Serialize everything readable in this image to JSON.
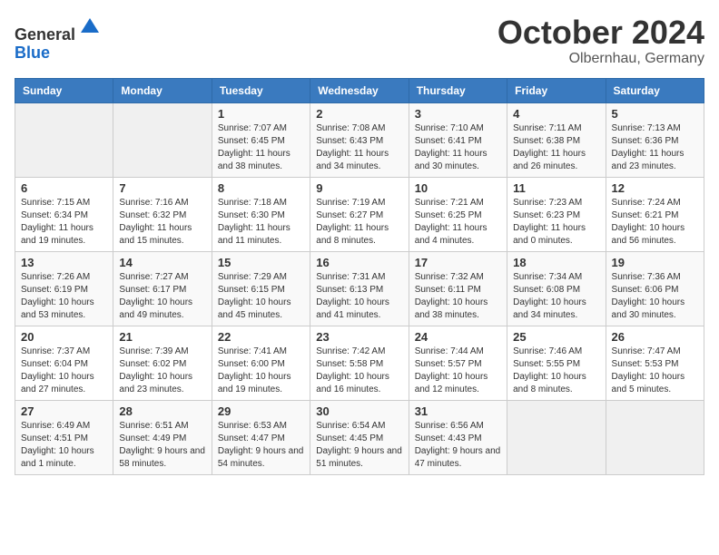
{
  "header": {
    "logo": {
      "line1": "General",
      "line2": "Blue"
    },
    "month": "October 2024",
    "location": "Olbernhau, Germany"
  },
  "weekdays": [
    "Sunday",
    "Monday",
    "Tuesday",
    "Wednesday",
    "Thursday",
    "Friday",
    "Saturday"
  ],
  "weeks": [
    [
      {
        "day": "",
        "info": ""
      },
      {
        "day": "",
        "info": ""
      },
      {
        "day": "1",
        "info": "Sunrise: 7:07 AM\nSunset: 6:45 PM\nDaylight: 11 hours and 38 minutes."
      },
      {
        "day": "2",
        "info": "Sunrise: 7:08 AM\nSunset: 6:43 PM\nDaylight: 11 hours and 34 minutes."
      },
      {
        "day": "3",
        "info": "Sunrise: 7:10 AM\nSunset: 6:41 PM\nDaylight: 11 hours and 30 minutes."
      },
      {
        "day": "4",
        "info": "Sunrise: 7:11 AM\nSunset: 6:38 PM\nDaylight: 11 hours and 26 minutes."
      },
      {
        "day": "5",
        "info": "Sunrise: 7:13 AM\nSunset: 6:36 PM\nDaylight: 11 hours and 23 minutes."
      }
    ],
    [
      {
        "day": "6",
        "info": "Sunrise: 7:15 AM\nSunset: 6:34 PM\nDaylight: 11 hours and 19 minutes."
      },
      {
        "day": "7",
        "info": "Sunrise: 7:16 AM\nSunset: 6:32 PM\nDaylight: 11 hours and 15 minutes."
      },
      {
        "day": "8",
        "info": "Sunrise: 7:18 AM\nSunset: 6:30 PM\nDaylight: 11 hours and 11 minutes."
      },
      {
        "day": "9",
        "info": "Sunrise: 7:19 AM\nSunset: 6:27 PM\nDaylight: 11 hours and 8 minutes."
      },
      {
        "day": "10",
        "info": "Sunrise: 7:21 AM\nSunset: 6:25 PM\nDaylight: 11 hours and 4 minutes."
      },
      {
        "day": "11",
        "info": "Sunrise: 7:23 AM\nSunset: 6:23 PM\nDaylight: 11 hours and 0 minutes."
      },
      {
        "day": "12",
        "info": "Sunrise: 7:24 AM\nSunset: 6:21 PM\nDaylight: 10 hours and 56 minutes."
      }
    ],
    [
      {
        "day": "13",
        "info": "Sunrise: 7:26 AM\nSunset: 6:19 PM\nDaylight: 10 hours and 53 minutes."
      },
      {
        "day": "14",
        "info": "Sunrise: 7:27 AM\nSunset: 6:17 PM\nDaylight: 10 hours and 49 minutes."
      },
      {
        "day": "15",
        "info": "Sunrise: 7:29 AM\nSunset: 6:15 PM\nDaylight: 10 hours and 45 minutes."
      },
      {
        "day": "16",
        "info": "Sunrise: 7:31 AM\nSunset: 6:13 PM\nDaylight: 10 hours and 41 minutes."
      },
      {
        "day": "17",
        "info": "Sunrise: 7:32 AM\nSunset: 6:11 PM\nDaylight: 10 hours and 38 minutes."
      },
      {
        "day": "18",
        "info": "Sunrise: 7:34 AM\nSunset: 6:08 PM\nDaylight: 10 hours and 34 minutes."
      },
      {
        "day": "19",
        "info": "Sunrise: 7:36 AM\nSunset: 6:06 PM\nDaylight: 10 hours and 30 minutes."
      }
    ],
    [
      {
        "day": "20",
        "info": "Sunrise: 7:37 AM\nSunset: 6:04 PM\nDaylight: 10 hours and 27 minutes."
      },
      {
        "day": "21",
        "info": "Sunrise: 7:39 AM\nSunset: 6:02 PM\nDaylight: 10 hours and 23 minutes."
      },
      {
        "day": "22",
        "info": "Sunrise: 7:41 AM\nSunset: 6:00 PM\nDaylight: 10 hours and 19 minutes."
      },
      {
        "day": "23",
        "info": "Sunrise: 7:42 AM\nSunset: 5:58 PM\nDaylight: 10 hours and 16 minutes."
      },
      {
        "day": "24",
        "info": "Sunrise: 7:44 AM\nSunset: 5:57 PM\nDaylight: 10 hours and 12 minutes."
      },
      {
        "day": "25",
        "info": "Sunrise: 7:46 AM\nSunset: 5:55 PM\nDaylight: 10 hours and 8 minutes."
      },
      {
        "day": "26",
        "info": "Sunrise: 7:47 AM\nSunset: 5:53 PM\nDaylight: 10 hours and 5 minutes."
      }
    ],
    [
      {
        "day": "27",
        "info": "Sunrise: 6:49 AM\nSunset: 4:51 PM\nDaylight: 10 hours and 1 minute."
      },
      {
        "day": "28",
        "info": "Sunrise: 6:51 AM\nSunset: 4:49 PM\nDaylight: 9 hours and 58 minutes."
      },
      {
        "day": "29",
        "info": "Sunrise: 6:53 AM\nSunset: 4:47 PM\nDaylight: 9 hours and 54 minutes."
      },
      {
        "day": "30",
        "info": "Sunrise: 6:54 AM\nSunset: 4:45 PM\nDaylight: 9 hours and 51 minutes."
      },
      {
        "day": "31",
        "info": "Sunrise: 6:56 AM\nSunset: 4:43 PM\nDaylight: 9 hours and 47 minutes."
      },
      {
        "day": "",
        "info": ""
      },
      {
        "day": "",
        "info": ""
      }
    ]
  ],
  "colors": {
    "header_bg": "#3a7abf",
    "header_text": "#ffffff",
    "border": "#cccccc",
    "empty_bg": "#f0f0f0",
    "odd_row": "#f9f9f9",
    "even_row": "#ffffff"
  }
}
